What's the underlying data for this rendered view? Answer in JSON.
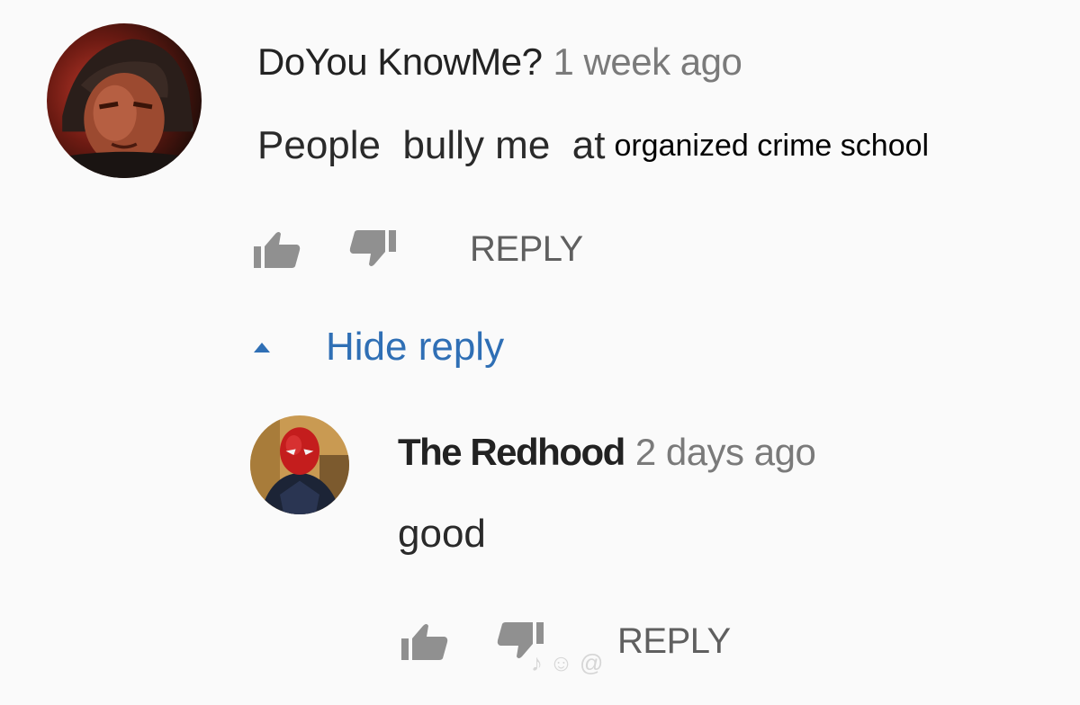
{
  "comments": [
    {
      "author": "DoYou KnowMe?",
      "time": "1 week ago",
      "text": "People  bully me  at",
      "overlay_text": "organized crime school",
      "reply_label": "REPLY",
      "avatar_icon": "soldier-portrait-avatar"
    },
    {
      "author": "The Redhood",
      "time": "2 days ago",
      "text": "good",
      "reply_label": "REPLY",
      "avatar_icon": "red-hood-avatar"
    }
  ],
  "thread": {
    "hide_reply_label": "Hide reply"
  },
  "icons": {
    "like": "thumbs-up-icon",
    "dislike": "thumbs-down-icon",
    "collapse": "caret-up-icon"
  },
  "colors": {
    "link_blue": "#2f6fb5",
    "icon_gray": "#909090",
    "text_dark": "#222222",
    "text_muted": "#7a7a7a"
  }
}
